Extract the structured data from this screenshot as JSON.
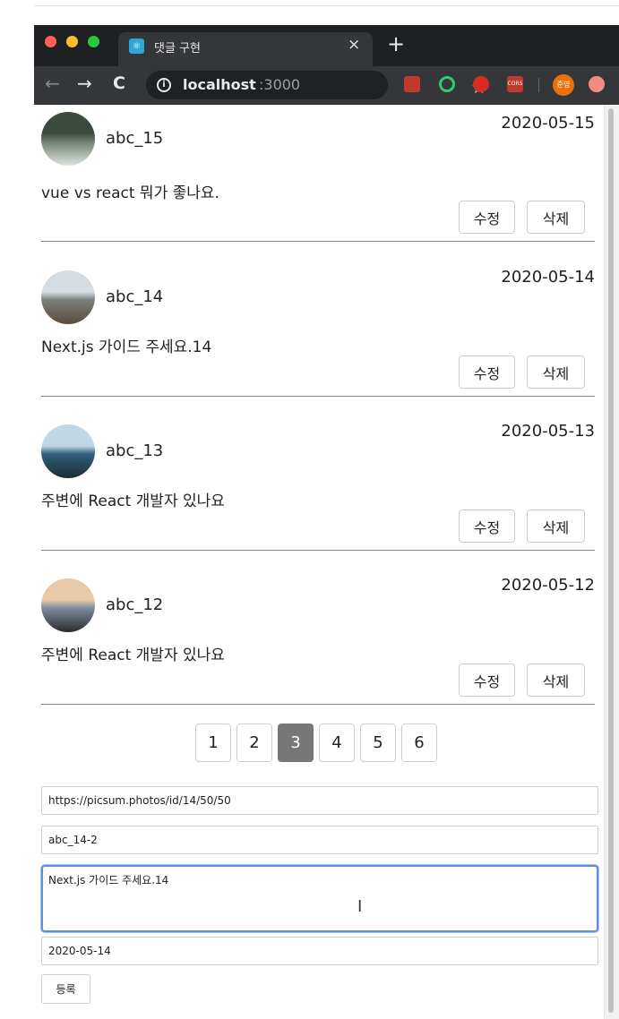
{
  "browser": {
    "tab_title": "댓글 구현",
    "tab_close": "×",
    "new_tab": "+",
    "url_host": "localhost",
    "url_port": ":3000",
    "profile_label": "준영",
    "extension_cors_label": "CORS",
    "icons": {
      "favicon": "react-atom-icon",
      "back": "back-arrow-icon",
      "forward": "forward-arrow-icon",
      "reload": "reload-icon",
      "info": "info-icon",
      "bookmark": "star-icon"
    },
    "glyphs": {
      "back": "←",
      "forward": "→",
      "reload": "C",
      "info": "i",
      "star": "☆"
    }
  },
  "comments": [
    {
      "user": "abc_15",
      "date": "2020-05-15",
      "text": "vue vs react 뭐가 좋나요.",
      "edit_label": "수정",
      "delete_label": "삭제",
      "avatar_palette": [
        "#3b4a3d",
        "#6f7e70",
        "#dfe5e0"
      ]
    },
    {
      "user": "abc_14",
      "date": "2020-05-14",
      "text": "Next.js 가이드 주세요.14",
      "edit_label": "수정",
      "delete_label": "삭제",
      "avatar_palette": [
        "#d6dde2",
        "#7a7f7c",
        "#5b4a3d"
      ]
    },
    {
      "user": "abc_13",
      "date": "2020-05-13",
      "text": "주변에 React 개발자 있나요",
      "edit_label": "수정",
      "delete_label": "삭제",
      "avatar_palette": [
        "#bfd7e6",
        "#2f5f7b",
        "#1e2b33"
      ]
    },
    {
      "user": "abc_12",
      "date": "2020-05-12",
      "text": "주변에 React 개발자 있나요",
      "edit_label": "수정",
      "delete_label": "삭제",
      "avatar_palette": [
        "#e8c9a6",
        "#7c8da0",
        "#2a2a2a"
      ]
    }
  ],
  "pagination": {
    "pages": [
      "1",
      "2",
      "3",
      "4",
      "5",
      "6"
    ],
    "active": "3"
  },
  "form": {
    "avatar_url": "https://picsum.photos/id/14/50/50",
    "username": "abc_14-2",
    "content": "Next.js 가이드 주세요.14",
    "date": "2020-05-14",
    "submit_label": "등록"
  },
  "colors": {
    "active_page": "#777777",
    "focus_ring": "#5b8fe6",
    "chrome_bg": "#1f2023"
  }
}
